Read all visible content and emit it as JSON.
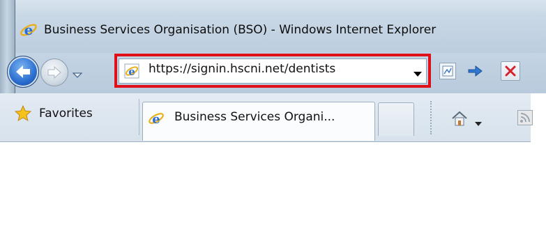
{
  "window": {
    "title": "Business Services Organisation (BSO) - Windows Internet Explorer"
  },
  "address_bar": {
    "url": "https://signin.hscni.net/dentists",
    "highlight_color": "#e0101a"
  },
  "favorites": {
    "label": "Favorites"
  },
  "tabs": [
    {
      "label": "Business Services Organi...",
      "active": true
    }
  ],
  "icons": {
    "ie": "ie-logo-icon",
    "back": "back-arrow-icon",
    "forward": "forward-arrow-icon",
    "compat": "compatibility-view-icon",
    "go": "go-arrow-icon",
    "stop": "stop-x-icon",
    "home": "home-icon",
    "feeds": "feeds-icon",
    "favorites": "favorites-star-icon"
  }
}
